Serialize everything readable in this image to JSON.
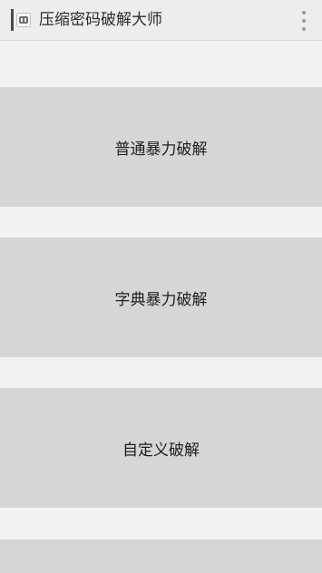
{
  "app": {
    "title": "压缩密码破解大师"
  },
  "buttons": [
    {
      "label": "普通暴力破解"
    },
    {
      "label": "字典暴力破解"
    },
    {
      "label": "自定义破解"
    },
    {
      "label": ""
    }
  ],
  "icons": {
    "app": "archive-app-icon",
    "overflow": "overflow-menu-icon"
  },
  "colors": {
    "action_bar": "#ededed",
    "background": "#f2f2f2",
    "button": "#d6d6d6"
  }
}
